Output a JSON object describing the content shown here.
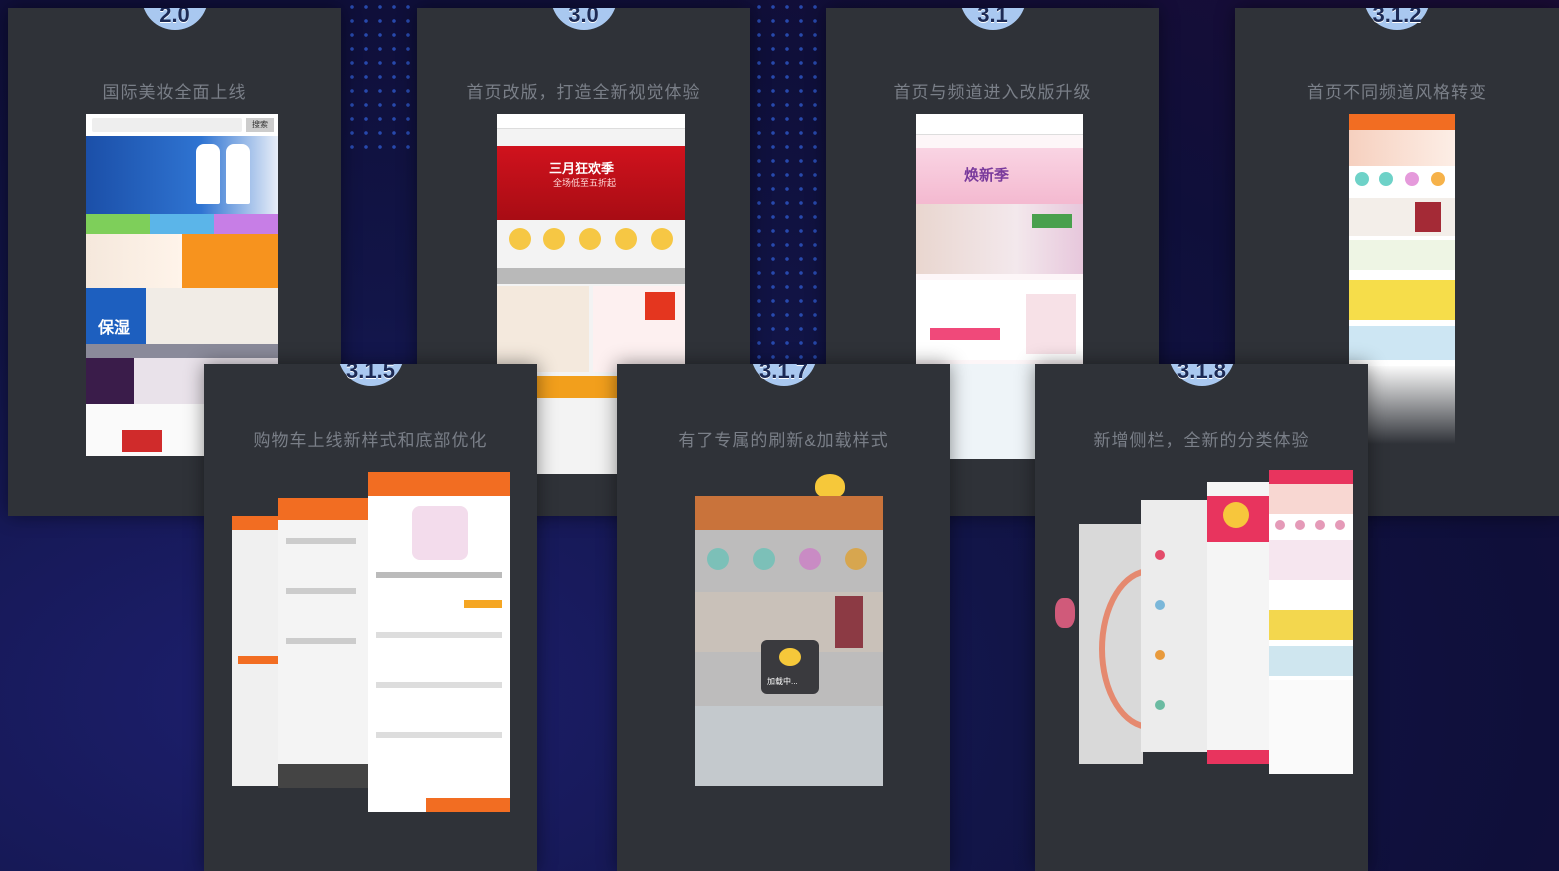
{
  "cards": [
    {
      "badge": "2.0",
      "title": "国际美妆全面上线"
    },
    {
      "badge": "3.0",
      "title": "首页改版，打造全新视觉体验"
    },
    {
      "badge": "3.1",
      "title": "首页与频道进入改版升级"
    },
    {
      "badge": "3.1.2",
      "title": "首页不同频道风格转变"
    },
    {
      "badge": "3.1.5",
      "title": "购物车上线新样式和底部优化"
    },
    {
      "badge": "3.1.7",
      "title": "有了专属的刷新&加载样式"
    },
    {
      "badge": "3.1.8",
      "title": "新增侧栏，全新的分类体验"
    }
  ],
  "screens": {
    "v20": {
      "search": "搜索",
      "banner_text": "保湿"
    },
    "v30": {
      "banner_title": "三月狂欢季",
      "banner_sub": "全场低至五折起"
    },
    "v31": {
      "banner_title": "焕新季"
    },
    "v317": {
      "loading_text": "加载中..."
    }
  }
}
